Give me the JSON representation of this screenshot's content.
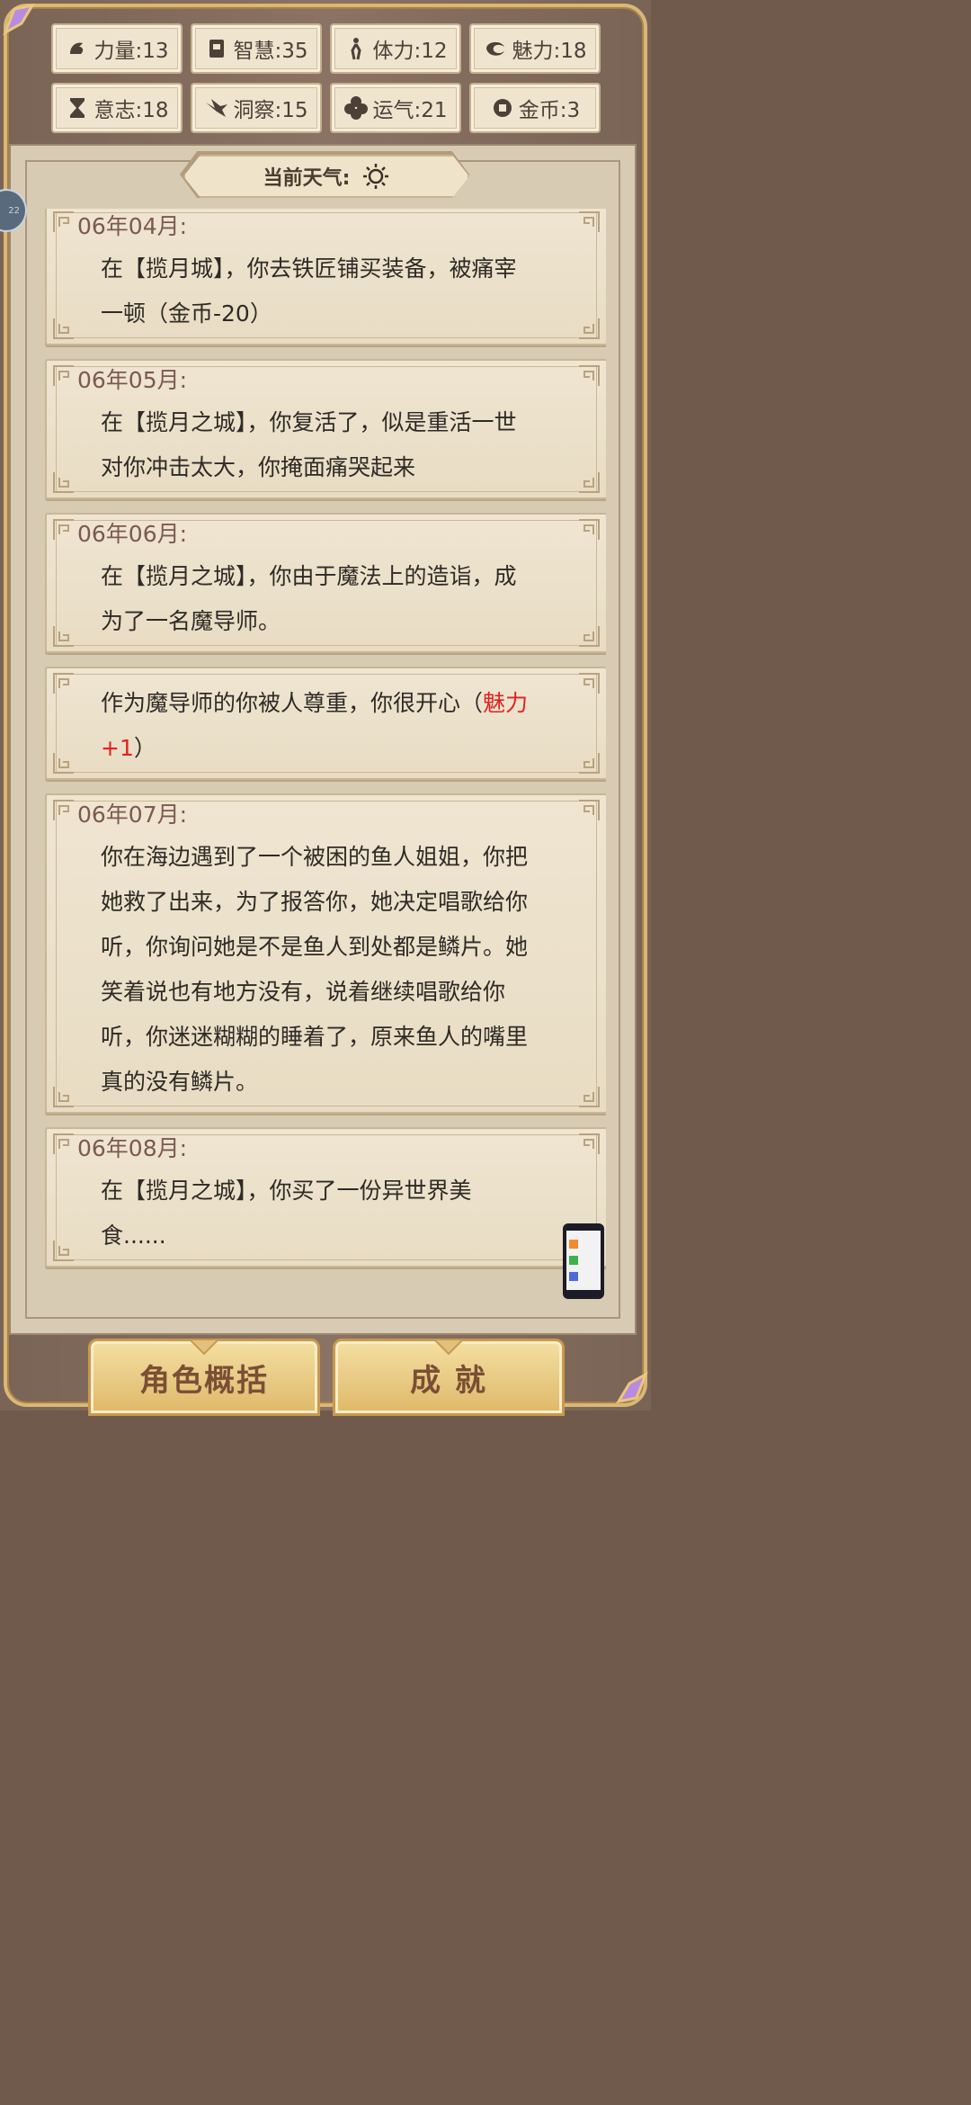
{
  "stats": [
    {
      "label": "力量:13",
      "icon": "arm-icon"
    },
    {
      "label": "智慧:35",
      "icon": "book-icon"
    },
    {
      "label": "体力:12",
      "icon": "running-figure-icon"
    },
    {
      "label": "魅力:18",
      "icon": "charm-icon"
    },
    {
      "label": "意志:18",
      "icon": "hourglass-icon"
    },
    {
      "label": "洞察:15",
      "icon": "eagle-icon"
    },
    {
      "label": "运气:21",
      "icon": "clover-icon"
    },
    {
      "label": "金币:3",
      "icon": "coin-icon"
    }
  ],
  "weather": {
    "label": "当前天气:",
    "icon": "sun-icon"
  },
  "side_bubble": {
    "label": "22"
  },
  "events": [
    {
      "date": "06年04月:",
      "text": "在【揽月城】，你去铁匠铺买装备，被痛宰一顿（金币-20）",
      "highlight": "",
      "tail": ""
    },
    {
      "date": "06年05月:",
      "text": "在【揽月之城】，你复活了，似是重活一世对你冲击太大，你掩面痛哭起来",
      "highlight": "",
      "tail": ""
    },
    {
      "date": "06年06月:",
      "text": "在【揽月之城】，你由于魔法上的造诣，成为了一名魔导师。",
      "highlight": "",
      "tail": ""
    },
    {
      "date": "",
      "text": "作为魔导师的你被人尊重，你很开心（",
      "highlight": "魅力+1",
      "tail": "）"
    },
    {
      "date": "06年07月:",
      "text": "你在海边遇到了一个被困的鱼人姐姐，你把她救了出来，为了报答你，她决定唱歌给你听，你询问她是不是鱼人到处都是鳞片。她笑着说也有地方没有，说着继续唱歌给你听，你迷迷糊糊的睡着了，原来鱼人的嘴里真的没有鳞片。",
      "highlight": "",
      "tail": ""
    },
    {
      "date": "06年08月:",
      "text": "在【揽月之城】，你买了一份异世界美食......",
      "highlight": "",
      "tail": ""
    }
  ],
  "buttons": {
    "summary": "角色概括",
    "achievements": "成 就"
  },
  "colors": {
    "accent_red": "#e12020",
    "gold": "#deb869",
    "text_brown": "#7b5950"
  }
}
